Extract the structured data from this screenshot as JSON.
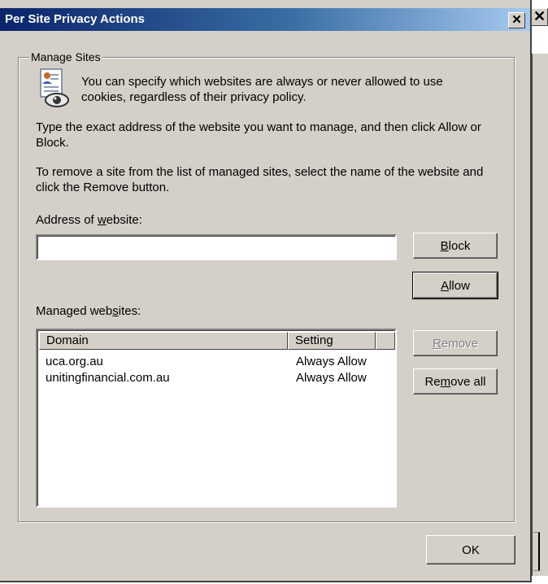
{
  "dialog": {
    "title": "Per Site Privacy Actions",
    "close_label": "✕"
  },
  "background": {
    "close_label": "✕"
  },
  "group": {
    "label": "Manage Sites"
  },
  "text": {
    "intro": "You can specify which websites are always or never allowed to use cookies, regardless of their privacy policy.",
    "para1": "Type the exact address of the website you want to manage, and then click Allow or Block.",
    "para2": "To remove a site from the list of managed sites, select the name of the website and click the Remove button."
  },
  "address": {
    "label_pre": "Address of ",
    "label_u": "w",
    "label_post": "ebsite:",
    "value": ""
  },
  "buttons": {
    "block_u": "B",
    "block_rest": "lock",
    "allow_u": "A",
    "allow_rest": "llow",
    "remove_u": "R",
    "remove_rest": "emove",
    "remove_all_pre": "Re",
    "remove_all_u": "m",
    "remove_all_post": "ove all",
    "ok": "OK"
  },
  "managed": {
    "label_pre": "Managed web",
    "label_u": "s",
    "label_post": "ites:",
    "columns": [
      "Domain",
      "Setting"
    ],
    "rows": [
      {
        "domain": "uca.org.au",
        "setting": "Always Allow"
      },
      {
        "domain": "unitingfinancial.com.au",
        "setting": "Always Allow"
      }
    ]
  },
  "icons": {
    "privacy": "privacy-document-eye-icon"
  }
}
